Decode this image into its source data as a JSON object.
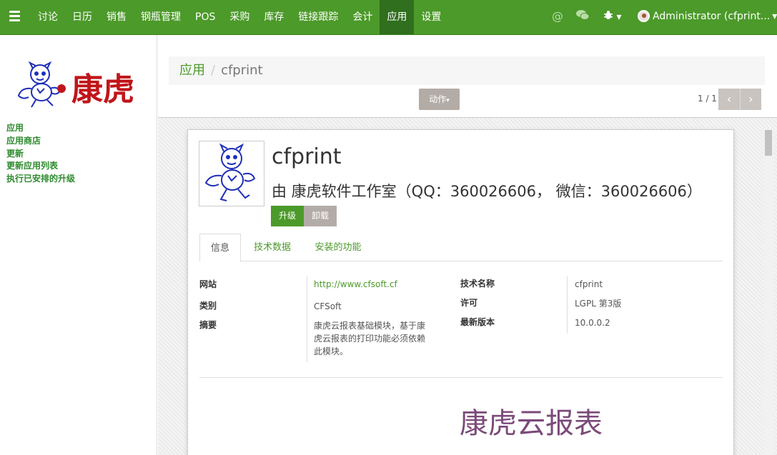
{
  "nav": {
    "items": [
      "讨论",
      "日历",
      "销售",
      "钢瓶管理",
      "POS",
      "采购",
      "库存",
      "链接跟踪",
      "会计",
      "应用",
      "设置"
    ],
    "active_index": 9,
    "user": "Administrator (cfprint...",
    "caret": "▾"
  },
  "sidebar": {
    "logo_text": "康虎",
    "links": [
      "应用",
      "应用商店",
      "更新",
      "更新应用列表",
      "执行已安排的升级"
    ]
  },
  "breadcrumb": {
    "parent": "应用",
    "separator": "/",
    "current": "cfprint"
  },
  "control": {
    "action_label": "动作",
    "pager_value": "1 / 1",
    "prev": "‹",
    "next": "›"
  },
  "module": {
    "name": "cfprint",
    "author": "由 康虎软件工作室（QQ：360026606， 微信：360026606）",
    "upgrade_label": "升级",
    "uninstall_label": "卸载"
  },
  "tabs": [
    "信息",
    "技术数据",
    "安装的功能"
  ],
  "info": {
    "website_label": "网站",
    "website": "http://www.cfsoft.cf",
    "category_label": "类别",
    "category": "CFSoft",
    "summary_label": "摘要",
    "summary_lines": [
      "康虎云报表基础模块，基于康",
      "虎云报表的打印功能必须依赖",
      "此模块。"
    ],
    "tech_name_label": "技术名称",
    "tech_name": "cfprint",
    "license_label": "许可",
    "license": "LGPL 第3版",
    "version_label": "最新版本",
    "version": "10.0.0.2"
  },
  "description_heading": "康虎云报表",
  "colors": {
    "brand": "#4c9a2a",
    "nav_active": "#2f6f1d",
    "secondary_button": "#b3aca6",
    "heading_purple": "#7b4a7a",
    "logo_red": "#c0151a",
    "logo_blue": "#1f2fb8"
  }
}
